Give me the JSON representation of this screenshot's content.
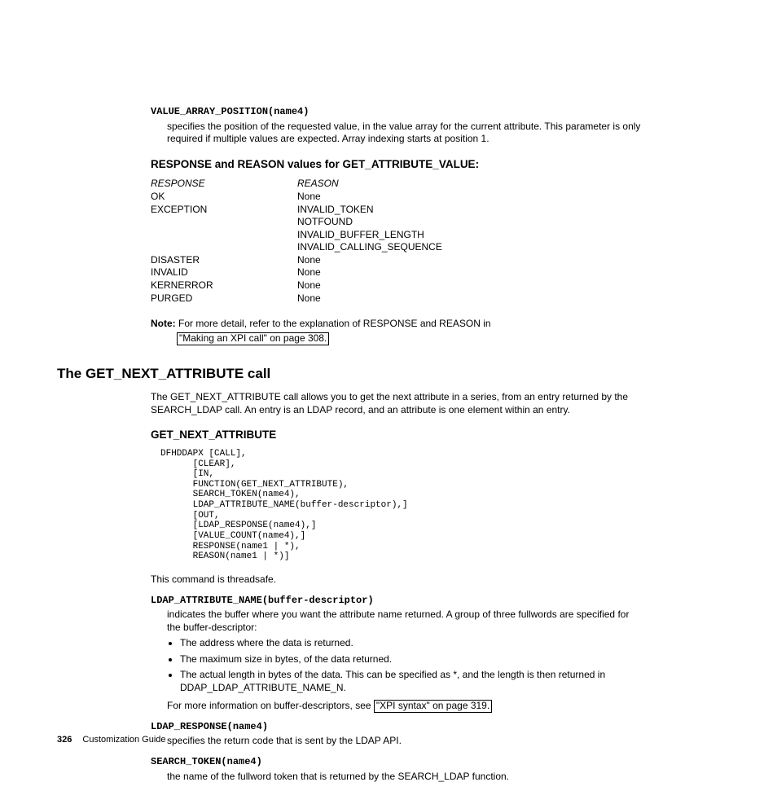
{
  "sec1": {
    "term": "VALUE_ARRAY_POSITION(name4)",
    "def": "specifies the position of the requested value, in the value array for the current attribute. This parameter is only required if multiple values are expected. Array indexing starts at position 1."
  },
  "rrHeading": "RESPONSE and REASON values for GET_ATTRIBUTE_VALUE:",
  "table": {
    "h1": "RESPONSE",
    "h2": "REASON",
    "rows": [
      {
        "r": "OK",
        "s": "None"
      },
      {
        "r": "EXCEPTION",
        "s": "INVALID_TOKEN"
      },
      {
        "r": "",
        "s": "NOTFOUND"
      },
      {
        "r": "",
        "s": "INVALID_BUFFER_LENGTH"
      },
      {
        "r": "",
        "s": "INVALID_CALLING_SEQUENCE"
      },
      {
        "r": "DISASTER",
        "s": "None"
      },
      {
        "r": "INVALID",
        "s": "None"
      },
      {
        "r": "KERNERROR",
        "s": "None"
      },
      {
        "r": "PURGED",
        "s": "None"
      }
    ]
  },
  "note": {
    "label": "Note:",
    "before": "For more detail, refer to the explanation of RESPONSE and REASON in",
    "xref": "\"Making an XPI call\" on page 308."
  },
  "h2": "The GET_NEXT_ATTRIBUTE call",
  "intro": "The GET_NEXT_ATTRIBUTE call allows you to get the next attribute in a series, from an entry returned by the SEARCH_LDAP call. An entry is an LDAP record, and an attribute is one element within an entry.",
  "subHeading": "GET_NEXT_ATTRIBUTE",
  "code": "DFHDDAPX [CALL],\n      [CLEAR],\n      [IN,\n      FUNCTION(GET_NEXT_ATTRIBUTE),\n      SEARCH_TOKEN(name4),\n      LDAP_ATTRIBUTE_NAME(buffer-descriptor),]\n      [OUT,\n      [LDAP_RESPONSE(name4),]\n      [VALUE_COUNT(name4),]\n      RESPONSE(name1 | *),\n      REASON(name1 | *)]",
  "threadsafe": "This command is threadsafe.",
  "attr1": {
    "term": "LDAP_ATTRIBUTE_NAME(buffer-descriptor)",
    "def": "indicates the buffer where you want the attribute name returned. A group of three fullwords are specified for the buffer-descriptor:",
    "b1": "The address where the data is returned.",
    "b2": "The maximum size in bytes, of the data returned.",
    "b3": "The actual length in bytes of the data. This can be specified as *, and the length is then returned in DDAP_LDAP_ATTRIBUTE_NAME_N.",
    "more": "For more information on buffer-descriptors, see",
    "xref": "\"XPI syntax\" on page 319."
  },
  "attr2": {
    "term": "LDAP_RESPONSE(name4)",
    "def": "specifies the return code that is sent by the LDAP API."
  },
  "attr3": {
    "term": "SEARCH_TOKEN(name4)",
    "def": "the name of the fullword token that is returned by the SEARCH_LDAP function."
  },
  "footer": {
    "page": "326",
    "title": "Customization Guide"
  }
}
